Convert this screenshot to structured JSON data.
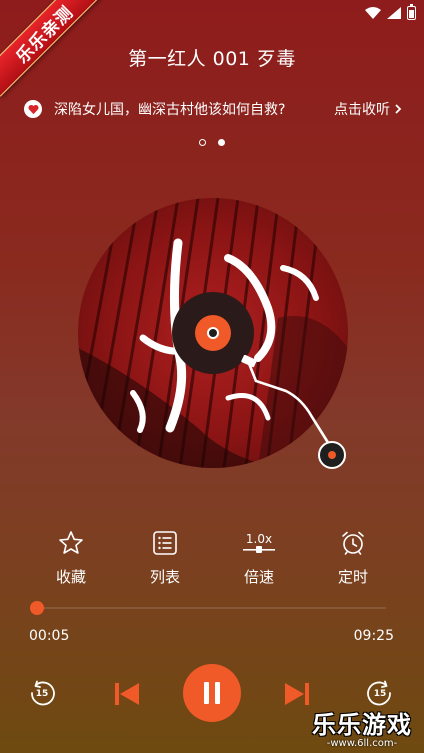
{
  "corner_badge": {
    "text": "乐乐亲测"
  },
  "header": {
    "title": "第一红人 001 歹毒"
  },
  "banner": {
    "text": "深陷女儿国，幽深古村他该如何自救?",
    "link": "点击收听"
  },
  "pager": {
    "count": 2,
    "active": 2
  },
  "actions": [
    {
      "label": "收藏",
      "icon": "star-icon"
    },
    {
      "label": "列表",
      "icon": "list-icon"
    },
    {
      "label": "倍速",
      "icon": "speed-icon",
      "value": "1.0x"
    },
    {
      "label": "定时",
      "icon": "alarm-clock-icon"
    }
  ],
  "player": {
    "current_time": "00:05",
    "total_time": "09:25",
    "progress": 0.009,
    "rewind_seconds": "15",
    "forward_seconds": "15",
    "accent_color": "#f05a28"
  },
  "watermark": {
    "title": "乐乐游戏",
    "url": "-www.6ll.com-"
  }
}
